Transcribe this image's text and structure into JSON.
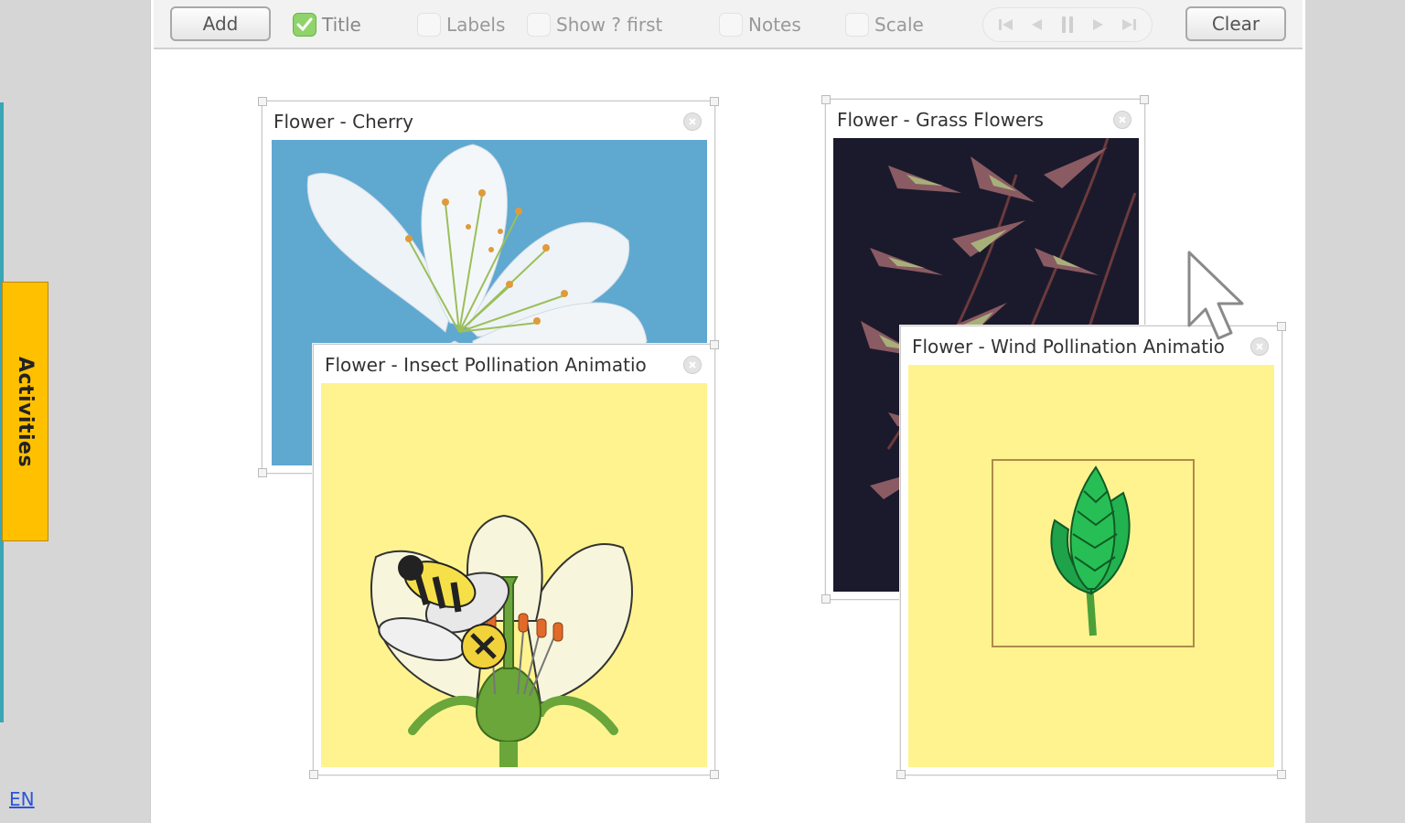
{
  "toolbar": {
    "add_label": "Add",
    "clear_label": "Clear",
    "options": [
      {
        "label": "Title",
        "checked": true
      },
      {
        "label": "Labels",
        "checked": false
      },
      {
        "label": "Show ? first",
        "checked": false
      },
      {
        "label": "Notes",
        "checked": false
      },
      {
        "label": "Scale",
        "checked": false
      }
    ],
    "player_icons": [
      "skip-to-start-icon",
      "step-back-icon",
      "pause-icon",
      "step-forward-icon",
      "skip-to-end-icon"
    ]
  },
  "sidebar": {
    "activities_label": "Activities",
    "language_link": "EN"
  },
  "panels": {
    "cherry": {
      "title": "Flower - Cherry"
    },
    "grass": {
      "title": "Flower - Grass Flowers"
    },
    "insect": {
      "title": "Flower - Insect Pollination Animatio"
    },
    "wind": {
      "title": "Flower - Wind Pollination Animatio"
    }
  },
  "colors": {
    "activities_tab": "#ffc000",
    "teal_edge": "#3aa5b5",
    "cherry_sky": "#5fa8d0",
    "animation_bg": "#fff38f",
    "checked_box": "#8fd36a"
  }
}
